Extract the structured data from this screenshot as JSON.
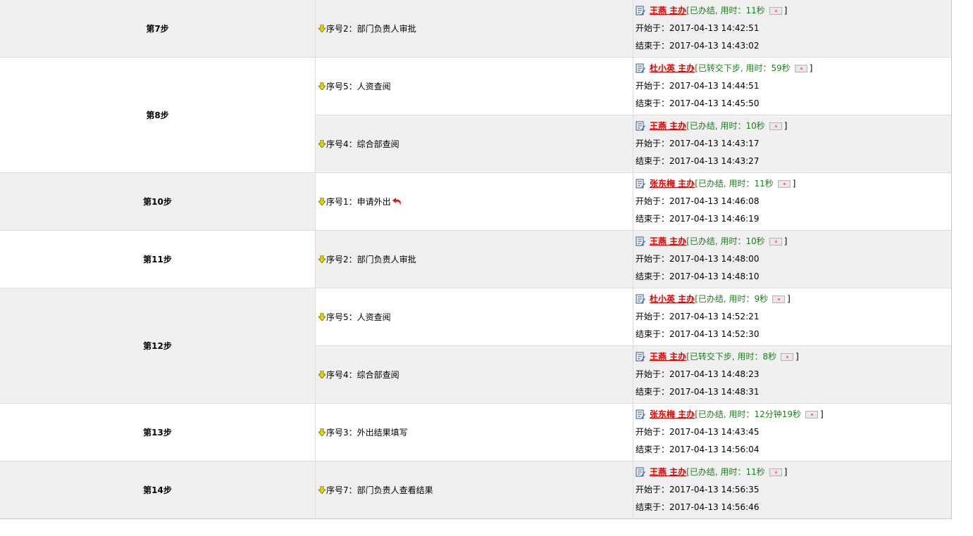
{
  "steps": [
    {
      "label": "第7步",
      "subs": [
        {
          "seq": "序号2：部门负责人审批",
          "return": false,
          "user": "王燕  主办",
          "status": "已办结, 用时：11秒",
          "start": "开始于：2017-04-13 14:42:51",
          "end": "结束于：2017-04-13 14:43:02"
        }
      ]
    },
    {
      "label": "第8步",
      "subs": [
        {
          "seq": "序号5：人资查阅",
          "return": false,
          "user": "杜小英  主办",
          "status": "已转交下步, 用时：59秒",
          "start": "开始于：2017-04-13 14:44:51",
          "end": "结束于：2017-04-13 14:45:50"
        },
        {
          "seq": "序号4：综合部查阅",
          "return": false,
          "user": "王燕  主办",
          "status": "已办结, 用时：10秒",
          "start": "开始于：2017-04-13 14:43:17",
          "end": "结束于：2017-04-13 14:43:27"
        }
      ]
    },
    {
      "label": "第10步",
      "subs": [
        {
          "seq": "序号1：申请外出",
          "return": true,
          "user": "张东梅  主办",
          "status": "已办结, 用时：11秒",
          "start": "开始于：2017-04-13 14:46:08",
          "end": "结束于：2017-04-13 14:46:19"
        }
      ]
    },
    {
      "label": "第11步",
      "subs": [
        {
          "seq": "序号2：部门负责人审批",
          "return": false,
          "user": "王燕  主办",
          "status": "已办结, 用时：10秒",
          "start": "开始于：2017-04-13 14:48:00",
          "end": "结束于：2017-04-13 14:48:10"
        }
      ]
    },
    {
      "label": "第12步",
      "subs": [
        {
          "seq": "序号5：人资查阅",
          "return": false,
          "user": "杜小英  主办",
          "status": "已办结, 用时：9秒",
          "start": "开始于：2017-04-13 14:52:21",
          "end": "结束于：2017-04-13 14:52:30"
        },
        {
          "seq": "序号4：综合部查阅",
          "return": false,
          "user": "王燕  主办",
          "status": "已转交下步, 用时：8秒",
          "start": "开始于：2017-04-13 14:48:23",
          "end": "结束于：2017-04-13 14:48:31"
        }
      ]
    },
    {
      "label": "第13步",
      "subs": [
        {
          "seq": "序号3：外出结果填写",
          "return": false,
          "user": "张东梅  主办",
          "status": "已办结, 用时：12分钟19秒",
          "start": "开始于：2017-04-13 14:43:45",
          "end": "结束于：2017-04-13 14:56:04"
        }
      ]
    },
    {
      "label": "第14步",
      "subs": [
        {
          "seq": "序号7：部门负责人查看结果",
          "return": false,
          "user": "王燕  主办",
          "status": "已办结, 用时：11秒",
          "start": "开始于：2017-04-13 14:56:35",
          "end": "结束于：2017-04-13 14:56:46"
        }
      ]
    }
  ],
  "icons": {
    "sequence": "down-arrow-icon",
    "record": "document-edit-icon",
    "detail": "mini-window-icon",
    "returned": "return-arrow-icon"
  },
  "colors": {
    "user": "#e00000",
    "status": "#1a7f1a",
    "row_alt": "#f0f0f0",
    "border": "#dcdcdc"
  }
}
